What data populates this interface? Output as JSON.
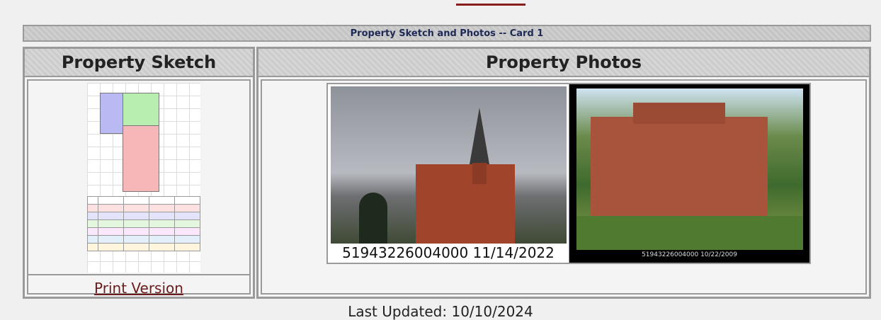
{
  "section_title": "Property Sketch and Photos -- Card 1",
  "sketch_panel": {
    "heading": "Property Sketch",
    "print_link": "Print Version"
  },
  "photos_panel": {
    "heading": "Property Photos",
    "photos": [
      {
        "caption": "51943226004000 11/14/2022"
      },
      {
        "caption": "51943226004000 10/22/2009"
      }
    ]
  },
  "last_updated": "Last Updated: 10/10/2024",
  "colors": {
    "link": "#6b1b1b",
    "border": "#9a9a9a",
    "title_text": "#1e2a55",
    "accent": "#8b1c1c"
  }
}
